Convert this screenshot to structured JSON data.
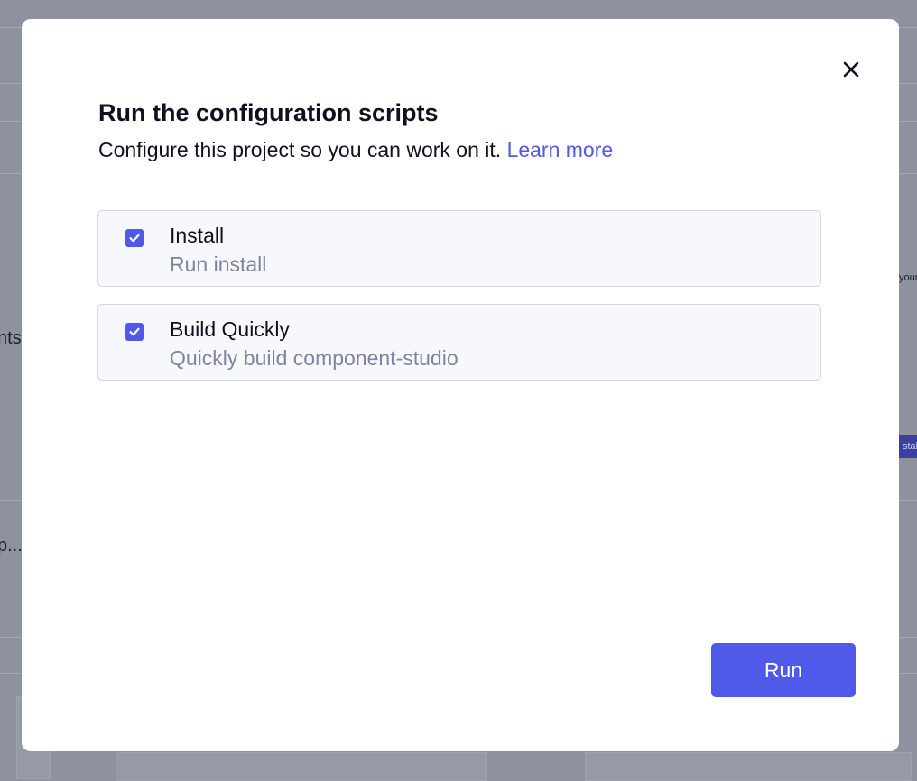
{
  "background": {
    "fragments": [
      "nts",
      "p...",
      "your",
      "stall"
    ]
  },
  "dialog": {
    "title": "Run the configuration scripts",
    "subtitle": "Configure this project so you can work on it.",
    "learn_more": "Learn more",
    "close_icon": "close-icon",
    "scripts": [
      {
        "name": "Install",
        "description": "Run install",
        "checked": true
      },
      {
        "name": "Build Quickly",
        "description": "Quickly build component-studio",
        "checked": true
      }
    ],
    "run_label": "Run"
  },
  "colors": {
    "accent": "#4f5ae8",
    "overlay": "#8e929e",
    "text": "#0f1120",
    "muted_text": "#7f84a0"
  }
}
